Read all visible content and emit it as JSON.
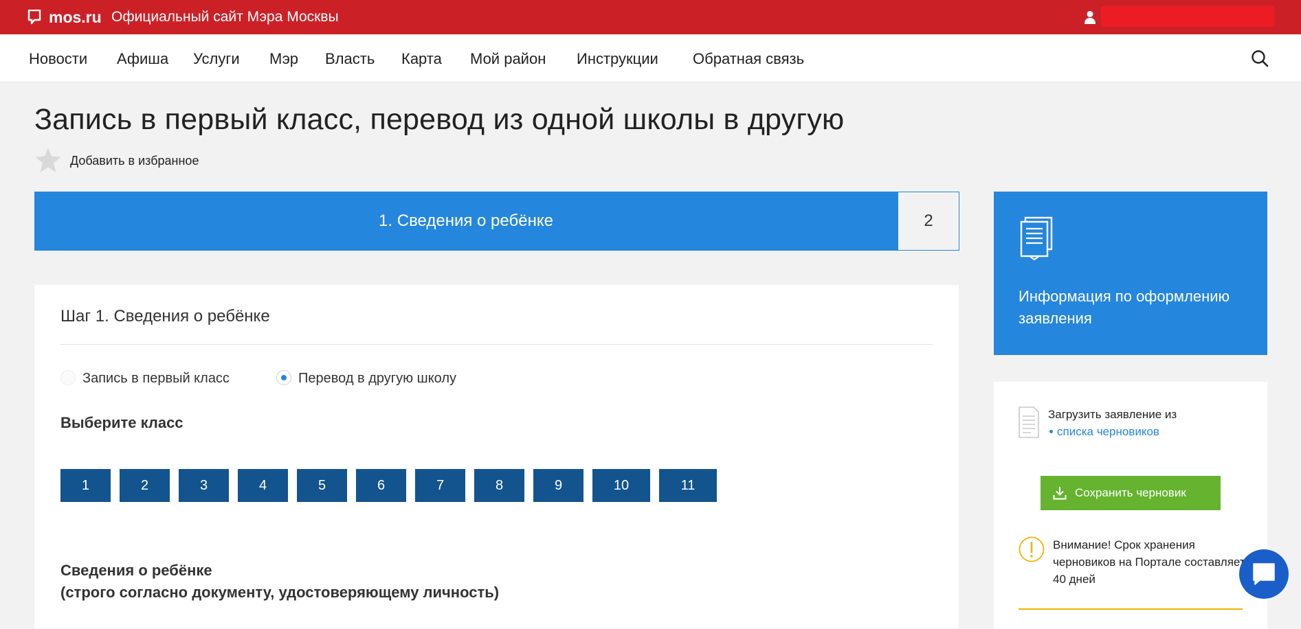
{
  "header": {
    "logo_text": "mos.ru",
    "site_title": "Официальный сайт Мэра Москвы",
    "colors": {
      "bar": "#cc2027",
      "user_box": "#ec1c24"
    }
  },
  "nav": {
    "items": [
      "Новости",
      "Афиша",
      "Услуги",
      "Мэр",
      "Власть",
      "Карта",
      "Мой район",
      "Инструкции",
      "Обратная связь"
    ],
    "search_icon": "search-icon"
  },
  "page": {
    "title": "Запись в первый класс, перевод из одной школы в другую",
    "favorite_label": "Добавить в избранное"
  },
  "steps": {
    "active_label": "1. Сведения о ребёнке",
    "next_label": "2"
  },
  "form": {
    "step_heading": "Шаг 1. Сведения о ребёнке",
    "radios": [
      {
        "label": "Запись в первый класс",
        "checked": false
      },
      {
        "label": "Перевод в другую школу",
        "checked": true
      }
    ],
    "class_heading": "Выберите класс",
    "classes": [
      "1",
      "2",
      "3",
      "4",
      "5",
      "6",
      "7",
      "8",
      "9",
      "10",
      "11"
    ],
    "child_heading_line1": "Сведения о ребёнке",
    "child_heading_line2": "(строго согласно документу, удостоверяющему личность)"
  },
  "sidebar": {
    "info_title": "Информация по оформлению заявления",
    "draft_text": "Загрузить заявление из",
    "draft_link": "списка черновиков",
    "save_button": "Сохранить черновик",
    "warning": "Внимание! Срок хранения черновиков на Портале составляет 40 дней",
    "colors": {
      "accent": "#2586dd",
      "save": "#65b32e",
      "warning": "#f0b400",
      "class_button": "#13548f"
    }
  }
}
